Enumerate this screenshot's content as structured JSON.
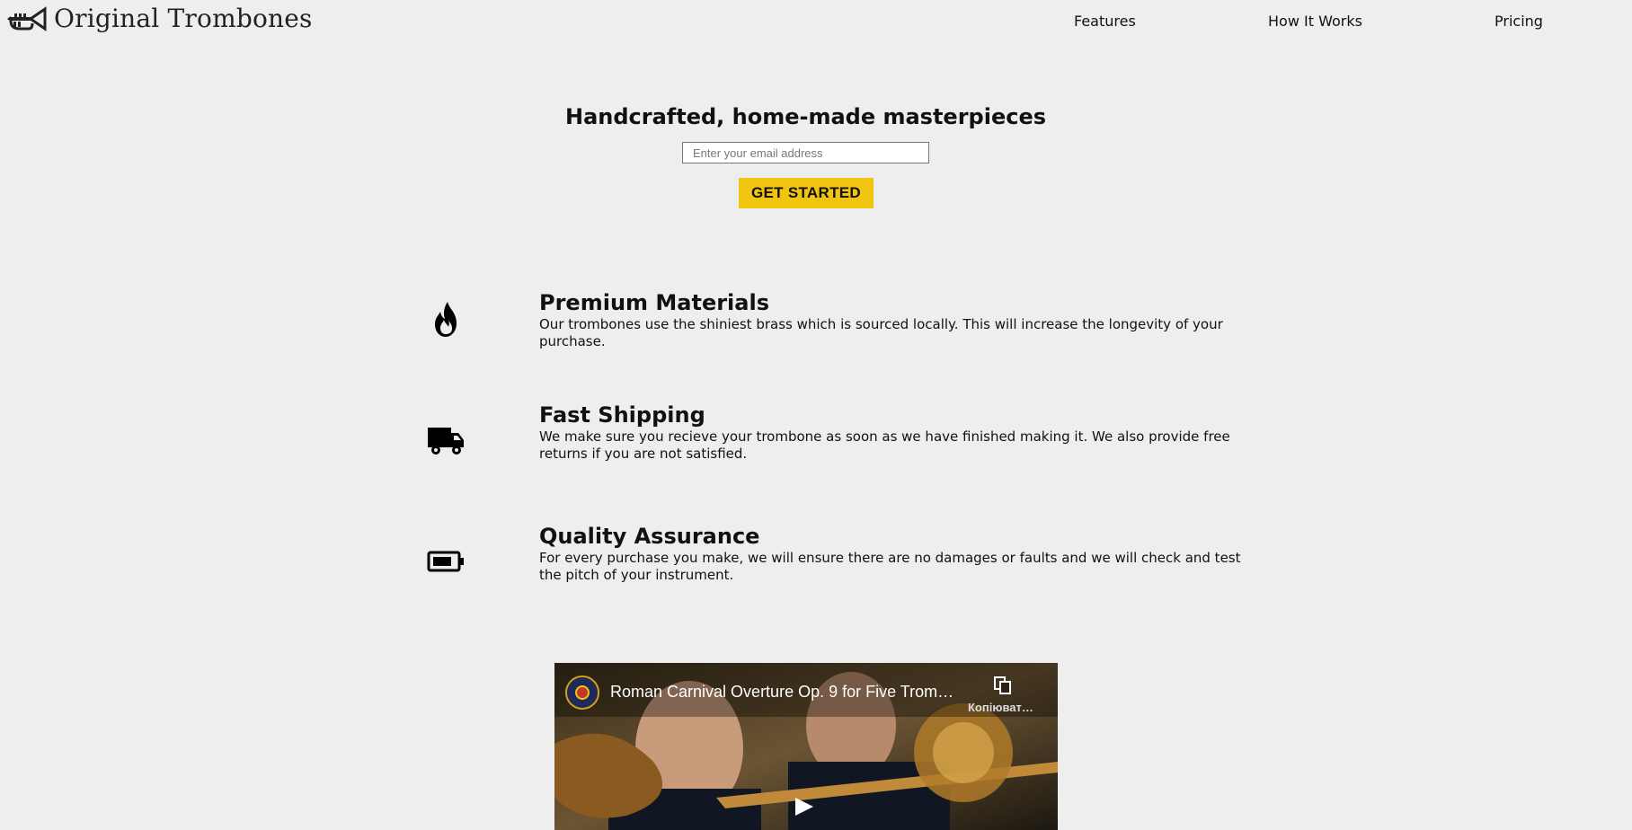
{
  "header": {
    "brand": "Original Trombones",
    "logo_icon": "trumpet-icon",
    "nav": [
      {
        "label": "Features"
      },
      {
        "label": "How It Works"
      },
      {
        "label": "Pricing"
      }
    ]
  },
  "hero": {
    "title": "Handcrafted, home-made masterpieces",
    "email_placeholder": "Enter your email address",
    "cta_label": "GET STARTED",
    "cta_color": "#f1c40f"
  },
  "features": [
    {
      "icon": "fire-icon",
      "title": "Premium Materials",
      "description": "Our trombones use the shiniest brass which is sourced locally. This will increase the longevity of your purchase."
    },
    {
      "icon": "truck-icon",
      "title": "Fast Shipping",
      "description": "We make sure you recieve your trombone as soon as we have finished making it. We also provide free returns if you are not satisfied."
    },
    {
      "icon": "battery-icon",
      "title": "Quality Assurance",
      "description": "For every purchase you make, we will ensure there are no damages or faults and we will check and test the pitch of your instrument."
    }
  ],
  "video": {
    "title": "Roman Carnival Overture Op. 9 for Five Tromb…",
    "copy_label": "Копіюват…",
    "copy_icon": "copy-icon",
    "play_icon": "play-icon"
  }
}
